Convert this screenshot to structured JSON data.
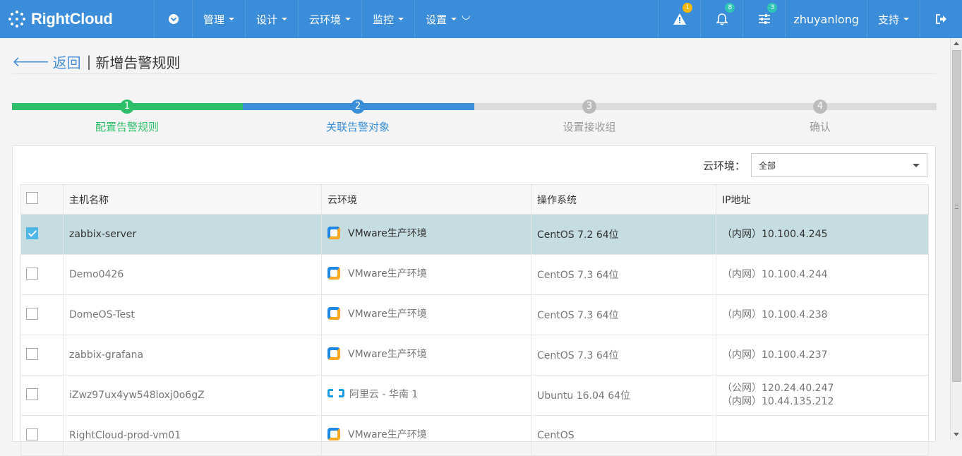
{
  "app": {
    "logo_text": "RightCloud"
  },
  "nav": {
    "items": [
      "管理",
      "设计",
      "云环境",
      "监控",
      "设置"
    ],
    "spinner": "◡"
  },
  "header_right": {
    "alerts": {
      "icon": "warning-icon",
      "count": "1",
      "color": "#f5b800"
    },
    "notifications": {
      "icon": "bell-icon",
      "count": "8",
      "color": "#2ec4b6"
    },
    "settings": {
      "icon": "sliders-icon",
      "count": "3",
      "color": "#2ec4b6"
    },
    "username": "zhuyanlong",
    "support_label": "支持",
    "logout_icon": "logout-icon"
  },
  "page": {
    "back_label": "返回",
    "title": "新增告警规则"
  },
  "steps": [
    {
      "number": "1",
      "label": "配置告警规则",
      "state": "done",
      "color": "#2ebf6b"
    },
    {
      "number": "2",
      "label": "关联告警对象",
      "state": "active",
      "color": "#3a8fd8"
    },
    {
      "number": "3",
      "label": "设置接收组",
      "state": "pending",
      "color": "#bbbbbb"
    },
    {
      "number": "4",
      "label": "确认",
      "state": "pending",
      "color": "#bbbbbb"
    }
  ],
  "filter": {
    "label": "云环境：",
    "selected": "全部"
  },
  "table": {
    "headers": [
      "主机名称",
      "云环境",
      "操作系统",
      "IP地址"
    ],
    "rows": [
      {
        "checked": true,
        "name": "zabbix-server",
        "env_icon": "vmware-icon",
        "env": "VMware生产环境",
        "os": "CentOS 7.2 64位",
        "ip_lines": [
          "",
          "（内网）10.100.4.245"
        ]
      },
      {
        "checked": false,
        "name": "Demo0426",
        "env_icon": "vmware-icon",
        "env": "VMware生产环境",
        "os": "CentOS 7.3 64位",
        "ip_lines": [
          "",
          "（内网）10.100.4.244"
        ]
      },
      {
        "checked": false,
        "name": "DomeOS-Test",
        "env_icon": "vmware-icon",
        "env": "VMware生产环境",
        "os": "CentOS 7.3 64位",
        "ip_lines": [
          "",
          "（内网）10.100.4.238"
        ]
      },
      {
        "checked": false,
        "name": "zabbix-grafana",
        "env_icon": "vmware-icon",
        "env": "VMware生产环境",
        "os": "CentOS 7.3 64位",
        "ip_lines": [
          "",
          "（内网）10.100.4.237"
        ]
      },
      {
        "checked": false,
        "name": "iZwz97ux4yw548loxj0o6gZ",
        "env_icon": "aliyun-icon",
        "env": "阿里云 - 华南 1",
        "os": "Ubuntu 16.04 64位",
        "ip_lines": [
          "（公网）120.24.40.247",
          "（内网）10.44.135.212"
        ]
      },
      {
        "checked": false,
        "name": "RightCloud-prod-vm01",
        "env_icon": "vmware-icon",
        "env": "VMware生产环境",
        "os": "CentOS",
        "ip_lines": [
          "",
          ""
        ]
      }
    ]
  }
}
